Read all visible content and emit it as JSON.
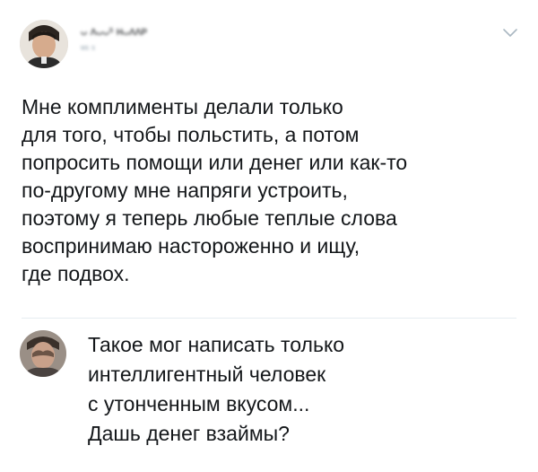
{
  "main_tweet": {
    "author_name": "ᴗ ᴧᴗᴗˢ ʜᴗᴧᴧᴘ",
    "author_handle": "ʷˢ ˢ",
    "menu_icon": "chevron-down-icon",
    "avatar_icon": "avatar-photo",
    "text_lines": [
      "Мне комплименты делали только",
      "для того, чтобы польстить, а потом",
      "попросить помощи или денег или как-то",
      "по-другому мне напряги устроить,",
      "поэтому я теперь любые теплые слова",
      "воспринимаю настороженно и ищу,",
      "где подвох."
    ]
  },
  "reply": {
    "avatar_icon": "avatar-photo",
    "text_lines": [
      "Такое мог написать только",
      "интеллигентный человек",
      "с утонченным вкусом...",
      "Дашь денег взаймы?"
    ]
  },
  "colors": {
    "text": "#14171a",
    "muted": "#8899a6",
    "divider": "#e6ecf0",
    "background": "#ffffff"
  }
}
